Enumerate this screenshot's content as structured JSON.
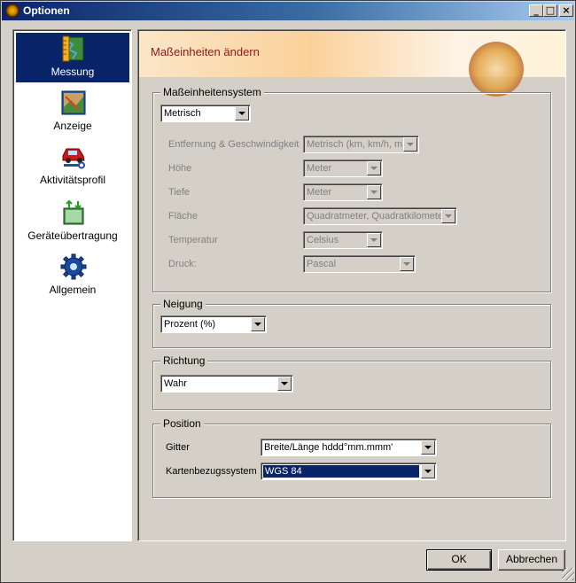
{
  "window": {
    "title": "Optionen"
  },
  "sidebar": {
    "items": [
      {
        "label": "Messung",
        "icon": "ruler-map-icon",
        "active": true
      },
      {
        "label": "Anzeige",
        "icon": "display-map-icon",
        "active": false
      },
      {
        "label": "Aktivitätsprofil",
        "icon": "car-wrench-icon",
        "active": false
      },
      {
        "label": "Geräteübertragung",
        "icon": "device-transfer-icon",
        "active": false
      },
      {
        "label": "Allgemein",
        "icon": "gear-icon",
        "active": false
      }
    ]
  },
  "main": {
    "title": "Maßeinheiten ändern",
    "units_group": {
      "legend": "Maßeinheitensystem",
      "system_value": "Metrisch",
      "rows": [
        {
          "label": "Entfernung & Geschwindigkeit",
          "value": "Metrisch (km, km/h, m)"
        },
        {
          "label": "Höhe",
          "value": "Meter"
        },
        {
          "label": "Tiefe",
          "value": "Meter"
        },
        {
          "label": "Fläche",
          "value": "Quadratmeter, Quadratkilometer"
        },
        {
          "label": "Temperatur",
          "value": "Celsius"
        },
        {
          "label": "Druck:",
          "value": "Pascal"
        }
      ]
    },
    "slope_group": {
      "legend": "Neigung",
      "value": "Prozent (%)"
    },
    "direction_group": {
      "legend": "Richtung",
      "value": "Wahr"
    },
    "position_group": {
      "legend": "Position",
      "grid_label": "Gitter",
      "grid_value": "Breite/Länge hddd°mm.mmm'",
      "datum_label": "Kartenbezugssystem",
      "datum_value": "WGS 84"
    }
  },
  "buttons": {
    "ok": "OK",
    "cancel": "Abbrechen"
  },
  "colors": {
    "selection": "#0a246a",
    "title_text": "#8b1a1a",
    "face": "#d4d0c8"
  }
}
